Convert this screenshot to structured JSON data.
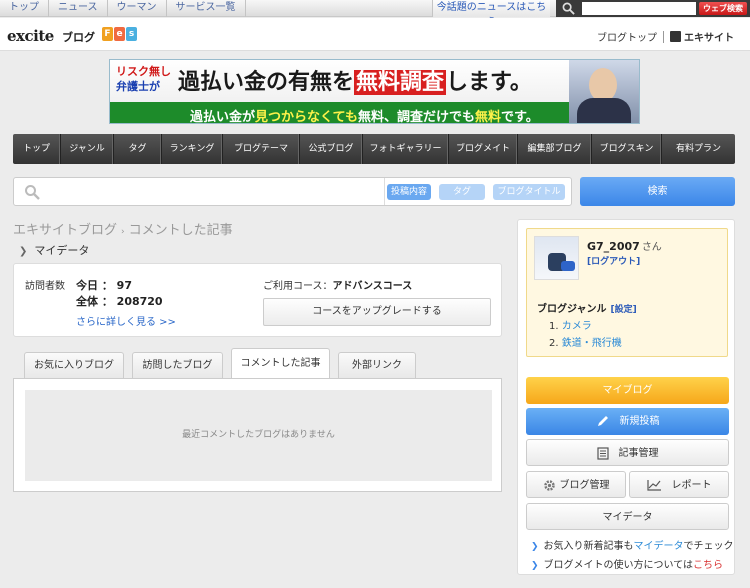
{
  "topnav": {
    "links": [
      "トップ",
      "ニュース",
      "ウーマン",
      "サービス一覧"
    ],
    "hot_news": "今話題のニュースはこちら",
    "search_placeholder": "",
    "web_search": "ウェブ検索"
  },
  "header": {
    "logo": "excite",
    "logo_sub": "ブログ",
    "fes": [
      "F",
      "e",
      "s"
    ],
    "blog_top": "ブログトップ",
    "exsite": "エキサイト"
  },
  "ad": {
    "line1a": "リスク無し",
    "line1b": "弁護士が",
    "main_pre": "過払い金の有無を",
    "main_hl": "無料調査",
    "main_post": "します。",
    "sub_a": "過払い金が",
    "sub_b": "見つからなくても",
    "sub_c": "無料、調査だけでも",
    "sub_d": "無料",
    "sub_e": "です。"
  },
  "mainnav": [
    "トップ",
    "ジャンル",
    "タグ",
    "ランキング",
    "ブログテーマ",
    "公式ブログ",
    "フォトギャラリー",
    "ブログメイト",
    "編集部ブログ",
    "ブログスキン",
    "有料プラン"
  ],
  "search": {
    "options": [
      "投稿内容",
      "タグ",
      "ブログタイトル"
    ],
    "button": "検索"
  },
  "breadcrumb": {
    "root": "エキサイトブログ",
    "sep": "›",
    "current": "コメントした記事"
  },
  "mydata_label": "マイデータ",
  "visitors": {
    "label": "訪問者数",
    "today": "今日 ： 97",
    "total": "全体 ： 208720",
    "more": "さらに詳しく見る >>",
    "course_label": "ご利用コース：",
    "course_value": "アドバンスコース",
    "upgrade": "コースをアップグレードする"
  },
  "tabs": [
    "お気に入りブログ",
    "訪問したブログ",
    "コメントした記事",
    "外部リンク"
  ],
  "empty_message": "最近コメントしたブログはありません",
  "sidebar": {
    "username": "G7_2007",
    "san": "さん",
    "logout": "[ログアウト]",
    "genre_label": "ブログジャンル",
    "genre_set": "[設定]",
    "genres": [
      "カメラ",
      "鉄道・飛行機"
    ],
    "btn_myblog": "マイブログ",
    "btn_new": "新規投稿",
    "btn_kanri": "記事管理",
    "btn_blogmgmt": "ブログ管理",
    "btn_report": "レポート",
    "btn_mydata": "マイデータ",
    "note1_a": "お気入り新着記事も",
    "note1_link": "マイデータ",
    "note1_b": "でチェック",
    "note2_a": "ブログメイトの使い方については",
    "note2_link": "こちら"
  }
}
